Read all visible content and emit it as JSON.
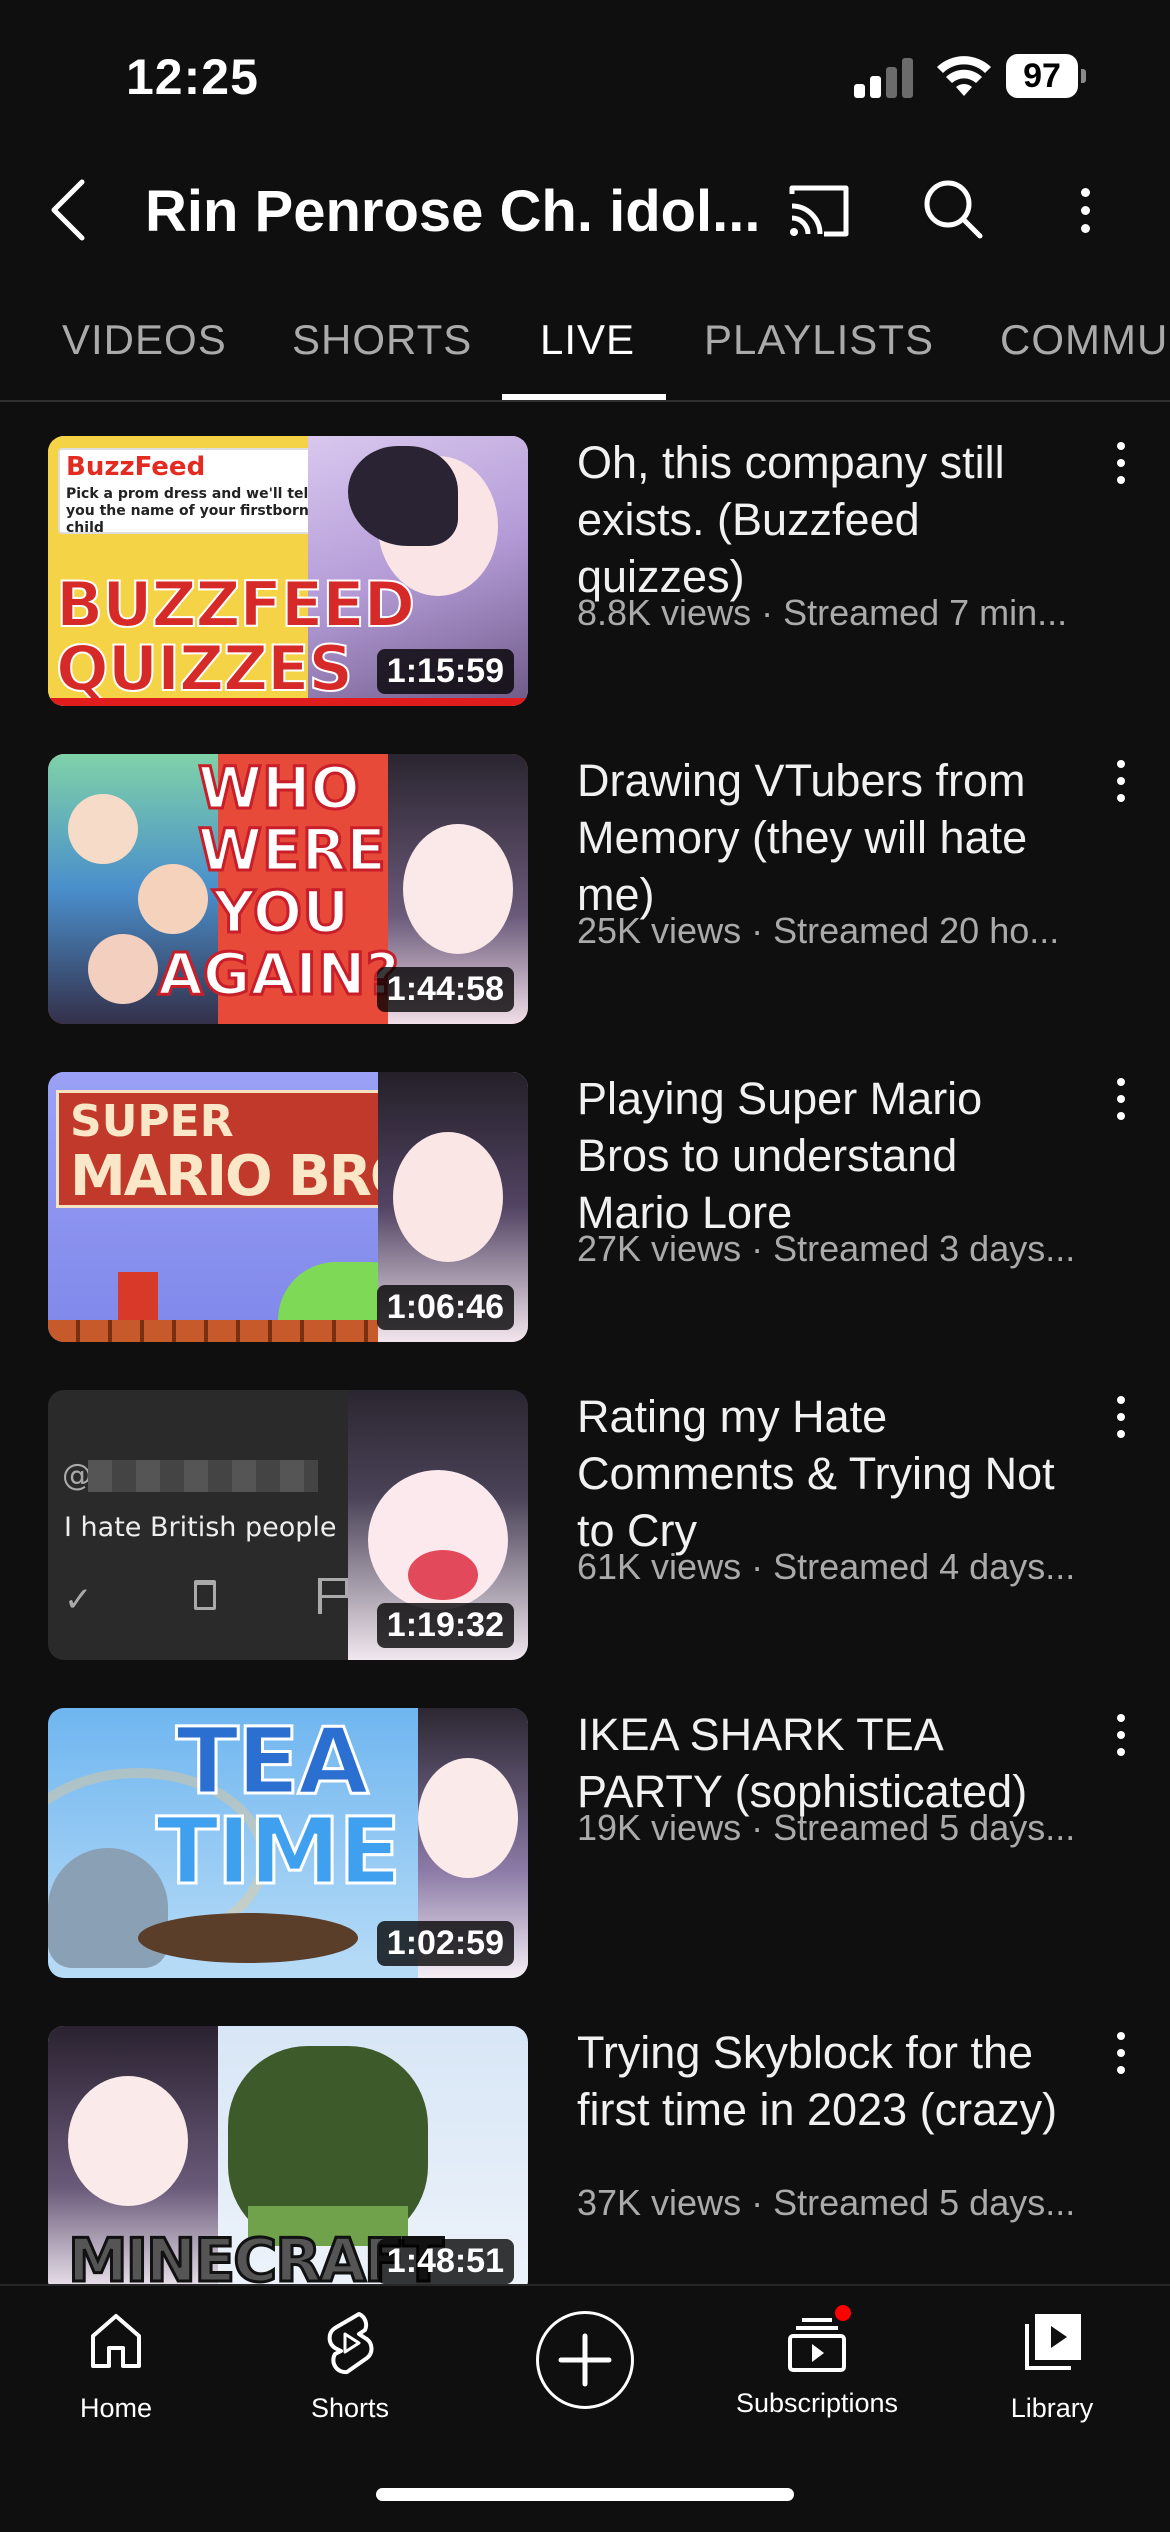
{
  "status_bar": {
    "time": "12:25",
    "battery": "97"
  },
  "header": {
    "title": "Rin Penrose Ch. idol...",
    "icons": [
      "back-icon",
      "cast-icon",
      "search-icon",
      "more-vert-icon"
    ]
  },
  "tabs": [
    {
      "label": "VIDEOS"
    },
    {
      "label": "SHORTS"
    },
    {
      "label": "LIVE",
      "active": true
    },
    {
      "label": "PLAYLISTS"
    },
    {
      "label": "COMMU"
    }
  ],
  "videos": [
    {
      "title": "Oh, this company still exists. (Buzzfeed quizzes)",
      "meta": "8.8K views · Streamed 7 min...",
      "duration": "1:15:59",
      "thumb_text": [
        "BuzzFeed",
        "Pick a prom dress and we'll tell you the name of your firstborn child",
        "BUZZFEED",
        "QUIZZES"
      ]
    },
    {
      "title": "Drawing VTubers from Memory (they will hate me)",
      "meta": "25K views · Streamed 20 ho...",
      "duration": "1:44:58",
      "thumb_text": [
        "WHO",
        "WERE",
        "YOU",
        "AGAIN?"
      ]
    },
    {
      "title": "Playing Super Mario Bros to understand Mario Lore",
      "meta": "27K views · Streamed 3 days...",
      "duration": "1:06:46",
      "thumb_text": [
        "SUPER",
        "MARIO BROS."
      ]
    },
    {
      "title": "Rating my Hate Comments & Trying Not to Cry",
      "meta": "61K views · Streamed 4 days...",
      "duration": "1:19:32",
      "thumb_text": [
        "@",
        "I hate British people"
      ]
    },
    {
      "title": "IKEA SHARK TEA PARTY (sophisticated)",
      "meta": "19K views · Streamed 5 days...",
      "duration": "1:02:59",
      "thumb_text": [
        "TEA",
        "TIME"
      ]
    },
    {
      "title": "Trying Skyblock for the first time in 2023 (crazy)",
      "meta": "37K views · Streamed 5 days...",
      "duration": "1:48:51",
      "thumb_text": [
        "MINECRAFT"
      ]
    }
  ],
  "bottom_nav": [
    {
      "label": "Home"
    },
    {
      "label": "Shorts"
    },
    {
      "label": ""
    },
    {
      "label": "Subscriptions"
    },
    {
      "label": "Library"
    }
  ],
  "colors": {
    "background": "#0f0f0f",
    "primary_text": "#f1f1f1",
    "secondary_text": "#aaaaaa",
    "notification_dot": "#ff0000"
  }
}
